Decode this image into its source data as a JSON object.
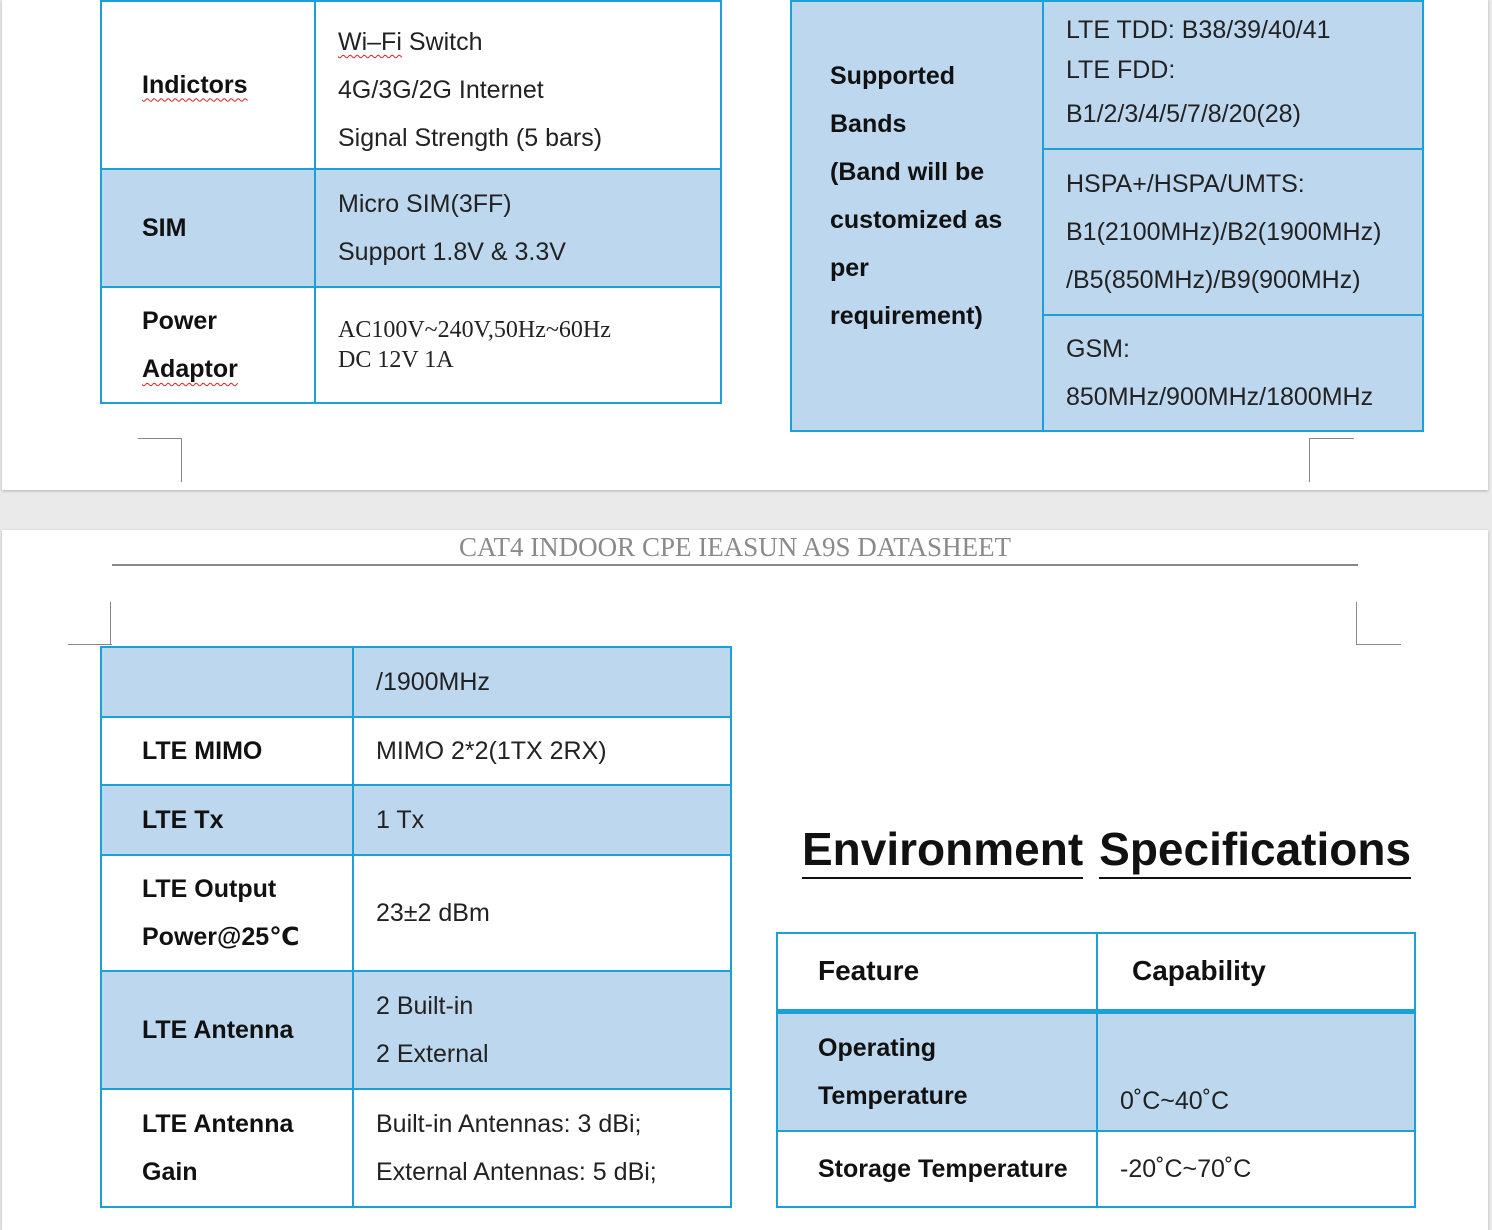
{
  "page1": {
    "left_table": [
      {
        "label": "Indictors",
        "label_flagged": true,
        "values": [
          "Wi-Fi Switch",
          "4G/3G/2G Internet",
          "Signal Strength (5 bars)"
        ],
        "shaded": false
      },
      {
        "label": "SIM",
        "values": [
          "Micro SIM(3FF)",
          "Support 1.8V & 3.3V"
        ],
        "shaded": true
      },
      {
        "label_lines": [
          "Power",
          "Adaptor"
        ],
        "values": [
          "AC100V~240V,50Hz~60Hz",
          "DC 12V 1A"
        ],
        "shaded": false
      }
    ],
    "bands_table": {
      "label_lines": [
        "Supported",
        "Bands",
        "(Band will be",
        "customized as",
        "per",
        "requirement)"
      ],
      "cells": [
        [
          "LTE TDD: B38/39/40/41",
          "LTE FDD:",
          "B1/2/3/4/5/7/8/20(28)"
        ],
        [
          "HSPA+/HSPA/UMTS:",
          "B1(2100MHz)/B2(1900MHz)",
          "/B5(850MHz)/B9(900MHz)"
        ],
        [
          "GSM:",
          "850MHz/900MHz/1800MHz"
        ]
      ]
    }
  },
  "page2": {
    "header": "CAT4 INDOOR CPE IEASUN A9S DATASHEET",
    "lte_table": [
      {
        "label": "",
        "values": [
          "/1900MHz"
        ],
        "shaded": true
      },
      {
        "label": "LTE MIMO",
        "values": [
          "MIMO 2*2(1TX 2RX)"
        ],
        "shaded": false
      },
      {
        "label": "LTE Tx",
        "values": [
          "1 Tx"
        ],
        "shaded": true
      },
      {
        "label_lines": [
          "LTE Output",
          "Power@25℃"
        ],
        "values": [
          "23±2 dBm"
        ],
        "shaded": false
      },
      {
        "label": "LTE Antenna",
        "values": [
          "2 Built-in",
          "2 External"
        ],
        "shaded": true
      },
      {
        "label_lines": [
          "LTE Antenna",
          "Gain"
        ],
        "values": [
          "Built-in Antennas: 3 dBi;",
          "External Antennas: 5 dBi;"
        ],
        "shaded": false
      }
    ],
    "env_title_words": [
      "Environment",
      "Specifications"
    ],
    "env_table": {
      "headers": [
        "Feature",
        "Capability"
      ],
      "rows": [
        {
          "label_lines": [
            "Operating",
            "Temperature"
          ],
          "value": "0˚C~40˚C"
        },
        {
          "label": "Storage Temperature",
          "value": "-20˚C~70˚C"
        }
      ]
    }
  },
  "colors": {
    "cell_shade": "#bdd7ee",
    "border": "#1ba1d6",
    "header_text": "#8a8a8a",
    "spell_flag": "#d42020"
  }
}
